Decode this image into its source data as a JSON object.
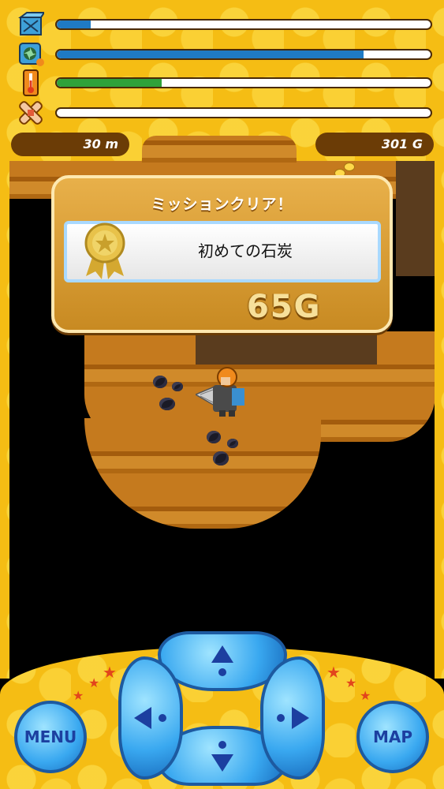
{
  "hud": {
    "bars": [
      {
        "icon": "fuel-box-icon",
        "level": 0.09,
        "color": "#1f7ac4"
      },
      {
        "icon": "oxygen-fan-icon",
        "level": 0.82,
        "color": "#1f7ac4"
      },
      {
        "icon": "thermometer-icon",
        "level": 0.28,
        "color": "#2fa23a"
      },
      {
        "icon": "bandage-icon",
        "level": 0.0,
        "color": "#2fa23a"
      }
    ],
    "depth": "30 m",
    "gold": "301 G"
  },
  "mission": {
    "title": "ミッションクリア！",
    "name": "初めての石炭",
    "reward": "65G"
  },
  "controls": {
    "menu_label": "MENU",
    "map_label": "MAP",
    "up_icon": "arrow-up-icon",
    "down_icon": "arrow-down-icon",
    "left_icon": "arrow-left-icon",
    "right_icon": "arrow-right-icon"
  },
  "colors": {
    "frame": "#f5bd14",
    "dirt": "#c57a1e",
    "button_blue": "#39a8f0"
  }
}
